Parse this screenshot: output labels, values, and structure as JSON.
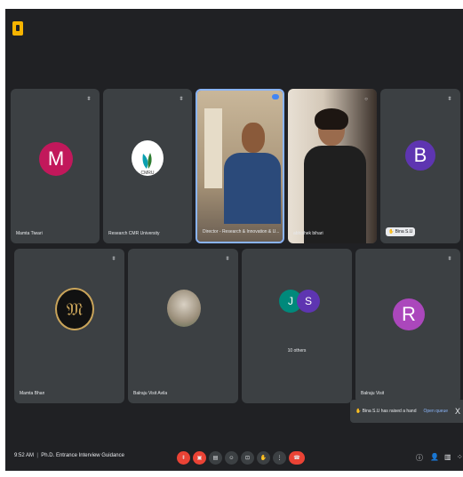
{
  "meeting": {
    "time": "9:52 AM",
    "title": "Ph.D. Entrance Interview Guidance"
  },
  "participants": [
    {
      "name": "Mamta Tiwari",
      "initial": "M",
      "color": "#c2185b"
    },
    {
      "name": "Research CMR University",
      "logo": "CMRU"
    },
    {
      "name": "Director - Research & Innovation & U...",
      "camera": true
    },
    {
      "name": "abhishek bihari",
      "camera": true
    },
    {
      "name": "Bina S.U",
      "initial": "B",
      "color": "#5e35b1"
    },
    {
      "name": "Mamta Bhan",
      "logo": "monogram"
    },
    {
      "name": "Balraju Visit Avila",
      "photo": true
    },
    {
      "name": "10 others",
      "initials": [
        "J",
        "S"
      ],
      "colors": [
        "#00897b",
        "#5e35b1"
      ]
    },
    {
      "name": "Balraju Visit",
      "initial": "R",
      "color": "#ab47bc"
    }
  ],
  "toast": {
    "text": "Bina S.U has raised a hand",
    "action": "Open queue",
    "close": "X"
  }
}
